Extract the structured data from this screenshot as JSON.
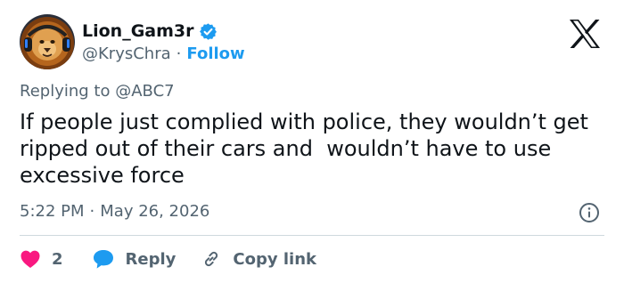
{
  "author": {
    "display_name": "Lion_Gam3r",
    "handle": "@KrysChra",
    "separator": "·",
    "follow_label": "Follow",
    "verified": true
  },
  "tweet": {
    "replying_prefix": "Replying to",
    "replying_to": "@ABC7",
    "text": "If people just complied with police, they wouldn’t get ripped out of their cars and  wouldn’t have to use excessive force",
    "time": "5:22 PM",
    "separator": "·",
    "date": "May 26, 2026"
  },
  "actions": {
    "like_count": "2",
    "reply_label": "Reply",
    "copy_link_label": "Copy link"
  },
  "icons": {
    "logo": "x-logo-icon",
    "verified": "verified-badge-icon",
    "info": "info-icon",
    "like": "heart-icon",
    "reply": "speech-bubble-icon",
    "copy": "link-icon"
  },
  "colors": {
    "accent": "#1d9bf0",
    "like": "#f91880",
    "text": "#0f1419",
    "secondary": "#536471"
  }
}
